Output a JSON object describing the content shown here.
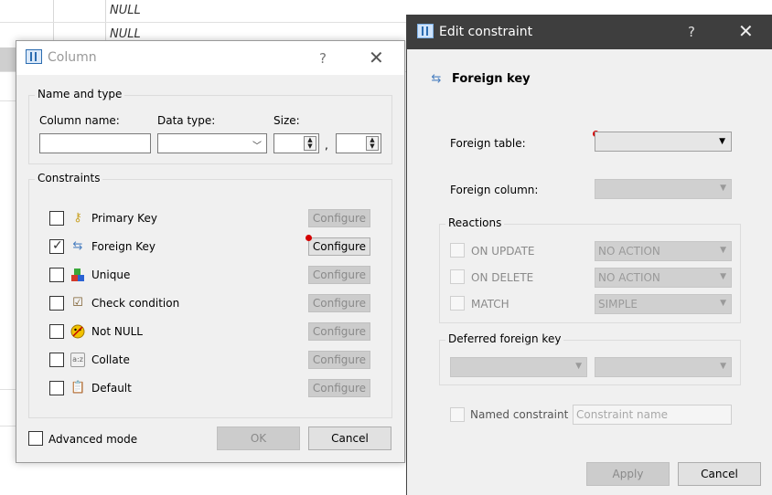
{
  "background": {
    "null_values": [
      "NULL",
      "NULL"
    ]
  },
  "column_dialog": {
    "title": "Column",
    "help": "?",
    "close": "✕",
    "name_type_group": "Name and type",
    "column_name_label": "Column name:",
    "column_name_value": "",
    "data_type_label": "Data type:",
    "data_type_value": "",
    "size_label": "Size:",
    "size_value": "",
    "size_separator": ",",
    "precision_value": "",
    "constraints_group": "Constraints",
    "constraints": [
      {
        "label": "Primary Key",
        "icon": "key-icon",
        "checked": false,
        "configure": "Configure",
        "configure_enabled": false
      },
      {
        "label": "Foreign Key",
        "icon": "foreign-key-icon",
        "checked": true,
        "configure": "Configure",
        "configure_enabled": true
      },
      {
        "label": "Unique",
        "icon": "unique-icon",
        "checked": false,
        "configure": "Configure",
        "configure_enabled": false
      },
      {
        "label": "Check condition",
        "icon": "check-condition-icon",
        "checked": false,
        "configure": "Configure",
        "configure_enabled": false
      },
      {
        "label": "Not NULL",
        "icon": "not-null-icon",
        "checked": false,
        "configure": "Configure",
        "configure_enabled": false
      },
      {
        "label": "Collate",
        "icon": "collate-icon",
        "checked": false,
        "configure": "Configure",
        "configure_enabled": false
      },
      {
        "label": "Default",
        "icon": "default-icon",
        "checked": false,
        "configure": "Configure",
        "configure_enabled": false
      }
    ],
    "advanced_mode": "Advanced mode",
    "ok": "OK",
    "cancel": "Cancel"
  },
  "edit_dialog": {
    "title": "Edit constraint",
    "help": "?",
    "close": "✕",
    "heading": "Foreign key",
    "foreign_table_label": "Foreign table:",
    "foreign_table_value": "",
    "foreign_column_label": "Foreign column:",
    "foreign_column_value": "",
    "reactions_group": "Reactions",
    "reactions": [
      {
        "label": "ON UPDATE",
        "value": "NO ACTION"
      },
      {
        "label": "ON DELETE",
        "value": "NO ACTION"
      },
      {
        "label": "MATCH",
        "value": "SIMPLE"
      }
    ],
    "deferred_group": "Deferred foreign key",
    "deferred_value_1": "",
    "deferred_value_2": "",
    "named_constraint_label": "Named constraint",
    "constraint_name_placeholder": "Constraint name",
    "apply": "Apply",
    "cancel": "Cancel"
  },
  "colors": {
    "title_bar_dark": "#3e3e3e",
    "dialog_bg": "#f0f0f0",
    "error_badge": "#d40000"
  }
}
